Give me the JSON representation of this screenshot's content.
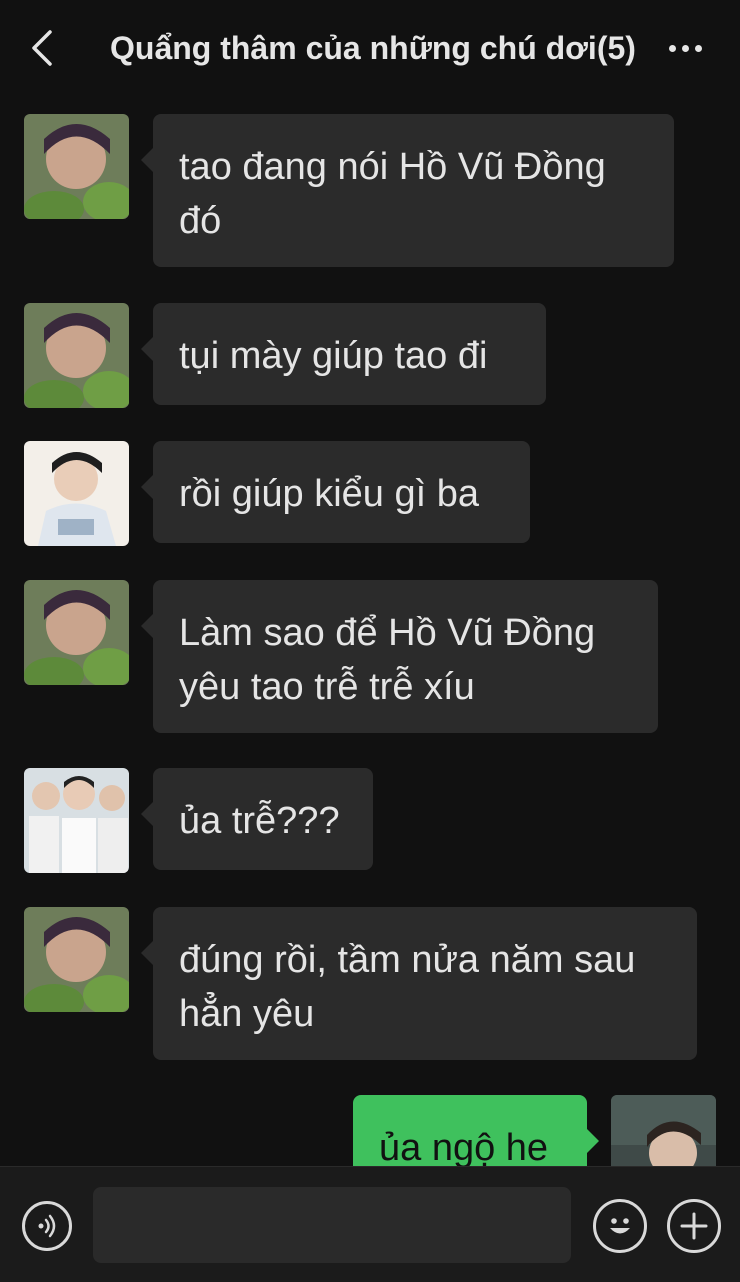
{
  "header": {
    "title": "Quẩng thâm của những chú dơi(5)",
    "back_icon": "chevron-left-icon",
    "more_icon": "more-dots-icon"
  },
  "messages": [
    {
      "sender": "friend-a",
      "text": "tao đang nói Hồ Vũ Đồng đó",
      "lines": [
        "tao đang nói Hồ Vũ Đồng",
        "đó"
      ]
    },
    {
      "sender": "friend-a",
      "text": "tụi mày giúp tao đi"
    },
    {
      "sender": "friend-b",
      "text": "rồi giúp kiểu gì ba"
    },
    {
      "sender": "friend-a",
      "text": "Làm sao để Hồ Vũ Đồng yêu tao trễ trễ xíu",
      "lines": [
        "Làm sao để Hồ Vũ Đồng",
        "yêu tao trễ trễ xíu"
      ]
    },
    {
      "sender": "friend-c",
      "text": "ủa trễ???"
    },
    {
      "sender": "friend-a",
      "text": "đúng rồi, tầm nửa năm sau hẳn yêu",
      "lines": [
        "đúng rồi, tầm nửa năm sau",
        "hẳn yêu"
      ]
    },
    {
      "sender": "me",
      "text": "ủa ngộ he"
    }
  ],
  "colors": {
    "background": "#111111",
    "bubble_other": "#2b2b2b",
    "bubble_mine": "#3fc15d"
  },
  "bottombar": {
    "voice_icon": "voice-icon",
    "emoji_icon": "emoji-icon",
    "add_icon": "plus-icon"
  }
}
